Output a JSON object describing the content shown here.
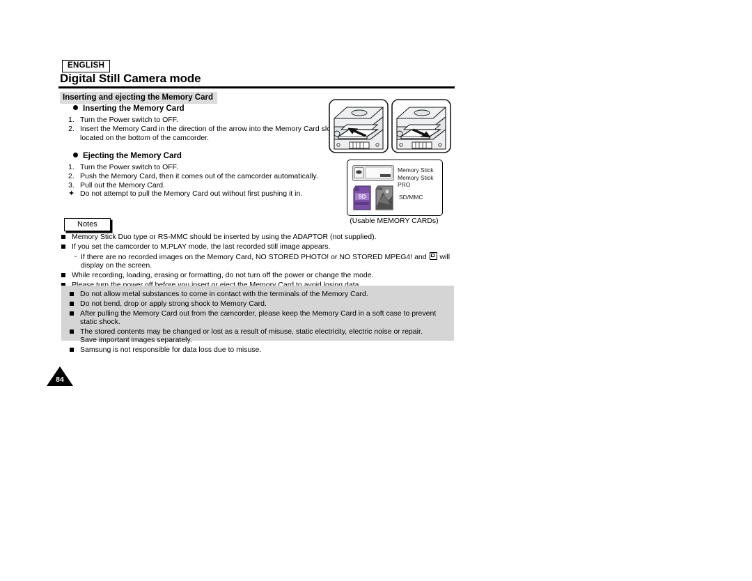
{
  "header": {
    "language_badge": "ENGLISH",
    "title": "Digital Still Camera mode"
  },
  "section": {
    "bar_title": "Inserting and ejecting the Memory Card"
  },
  "inserting": {
    "heading": "Inserting the Memory Card",
    "steps": [
      {
        "marker": "1.",
        "text": "Turn the Power switch to OFF."
      },
      {
        "marker": "2.",
        "text": "Insert the Memory Card in the direction of the arrow into the Memory Card slot",
        "continuation": "located on the bottom of the camcorder."
      }
    ]
  },
  "ejecting": {
    "heading": "Ejecting the Memory Card",
    "steps": [
      {
        "marker": "1.",
        "text": "Turn the Power switch to OFF."
      },
      {
        "marker": "2.",
        "text": "Push the Memory Card, then it comes out of the camcorder automatically."
      },
      {
        "marker": "3.",
        "text": "Pull out the Memory Card."
      },
      {
        "marker": "✦",
        "text": "Do not attempt to pull the Memory Card out without first pushing it in."
      }
    ]
  },
  "notes": {
    "label": "Notes",
    "items": [
      "Memory Stick Duo type or RS-MMC should be inserted by using the ADAPTOR (not supplied).",
      "If you set the camcorder to M.PLAY mode, the last recorded still image appears.",
      "While recording, loading, erasing or formatting, do not turn off the power or change the mode.",
      "Please turn the power off before you insert or eject the Memory Card to avoid losing data."
    ],
    "sub_item": {
      "dash": "-",
      "text_before_icon": "If there are no recorded images on the Memory Card, NO STORED PHOTO! or NO STORED MPEG4! and",
      "icon": "no-card-icon",
      "text_after_icon": "will",
      "continuation": "display on the screen."
    }
  },
  "caution": {
    "items": [
      "Do not allow metal substances to come in contact with the terminals of the Memory Card.",
      "Do not bend, drop or apply strong shock to Memory Card.",
      "After pulling the Memory Card out from the camcorder, please keep the Memory Card in a soft case to prevent static shock.",
      "The stored contents may be changed or lost as a result of misuse, static electricity, electric noise or repair.",
      "Samsung is not responsible for data loss due to misuse."
    ],
    "item4_continuation": "Save important images separately.",
    "background_color": "#d5d5d5"
  },
  "figures": {
    "insert_figure": "camcorder-insert-card-illustration",
    "eject_figure": "camcorder-eject-card-illustration",
    "cards": {
      "memory_stick_label_line1": "Memory Stick",
      "memory_stick_label_line2": "Memory Stick PRO",
      "sd_mmc_label": "SD/MMC",
      "sd_card_color": "#7B4FA8",
      "mmc_card_color": "#8a8a8a",
      "memory_stick_color": "#e8e8e8"
    },
    "caption": "(Usable MEMORY CARDs)"
  },
  "footer": {
    "page_number": "84"
  }
}
